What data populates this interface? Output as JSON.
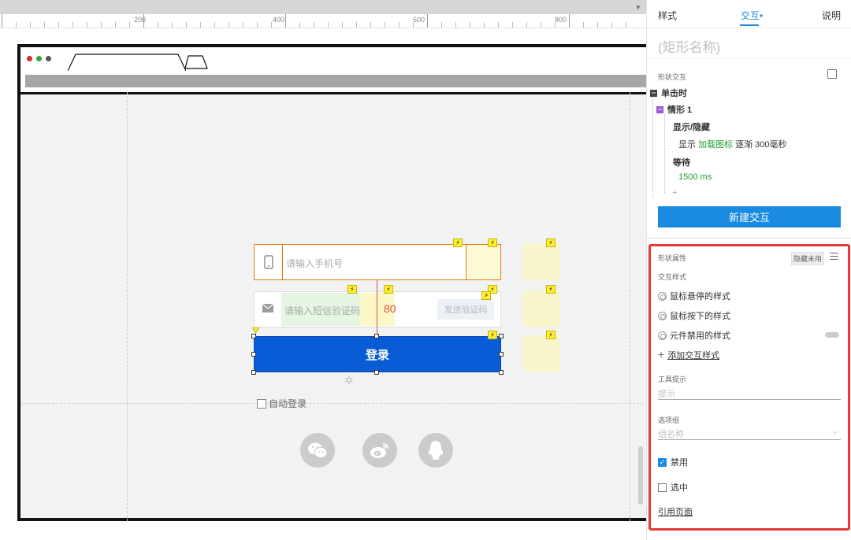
{
  "ruler": {
    "labels": [
      "200",
      "400",
      "600",
      "800"
    ]
  },
  "canvas": {
    "phone": {
      "placeholder": "请输入手机号"
    },
    "sms": {
      "placeholder": "请输入短信验证码",
      "countdown": "80",
      "send_label": "发送验证码"
    },
    "login": {
      "label": "登录"
    },
    "auto_login": {
      "label": "自动登录"
    },
    "social_icons": [
      "wechat-icon",
      "weibo-icon",
      "qq-icon"
    ],
    "bolt_glyph": "⚡",
    "colors": {
      "login_blue": "#0a5bd6",
      "accent_orange": "#e07a1a",
      "countdown_red": "#e74c3c"
    }
  },
  "panel": {
    "tabs": {
      "style": "样式",
      "interaction": "交互•",
      "notes": "说明"
    },
    "shape_name": "(矩形名称)",
    "shape_interaction_label": "形状交互",
    "on_click": "单击时",
    "case1": "情形 1",
    "action_show_hide": "显示/隐藏",
    "action_detail_prefix": "显示",
    "action_detail_target": "加载图标",
    "action_detail_suffix": "逐渐 300毫秒",
    "action_wait": "等待",
    "wait_ms": "1500 ms",
    "add_plus": "+",
    "new_interaction": "新建交互",
    "shape_props_label": "形状属性",
    "hidden_unused": "隐藏未用",
    "interaction_styles_label": "交互样式",
    "styles": [
      "鼠标悬停的样式",
      "鼠标按下的样式",
      "元件禁用的样式"
    ],
    "add_style": "添加交互样式",
    "tooltip_label": "工具提示",
    "tooltip_placeholder": "提示",
    "option_group_label": "选项组",
    "option_group_placeholder": "组名称",
    "disabled_label": "禁用",
    "disabled_checked": true,
    "selected_label": "选中",
    "selected_checked": false,
    "ref_page": "引用页面",
    "colors": {
      "accent": "#1a8be0",
      "highlight_red": "#e53935",
      "green": "#1d9e2d"
    }
  }
}
